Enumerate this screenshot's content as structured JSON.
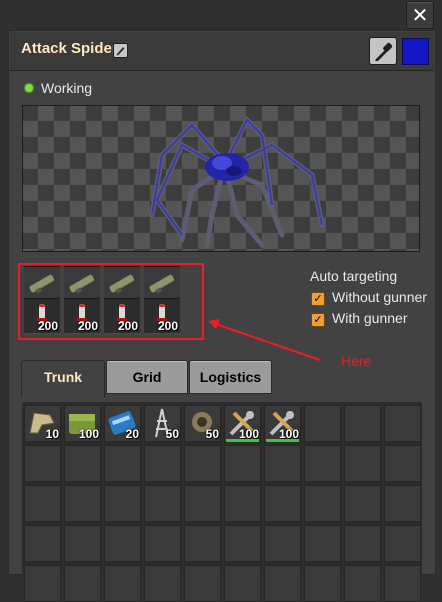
{
  "window": {
    "title": "Attack Spider",
    "close_glyph": "✕",
    "color_swatch": "#1216c4"
  },
  "status": {
    "text": "Working",
    "color": "#7de22f"
  },
  "ammo_slots": {
    "guns": [
      {
        "icon": "rocket-launcher-icon"
      },
      {
        "icon": "rocket-launcher-icon"
      },
      {
        "icon": "rocket-launcher-icon"
      },
      {
        "icon": "rocket-launcher-icon"
      }
    ],
    "ammo": [
      {
        "icon": "rocket-icon",
        "count": "200"
      },
      {
        "icon": "rocket-icon",
        "count": "200"
      },
      {
        "icon": "rocket-icon",
        "count": "200"
      },
      {
        "icon": "rocket-icon",
        "count": "200"
      }
    ]
  },
  "auto_targeting": {
    "title": "Auto targeting",
    "options": [
      {
        "label": "Without gunner",
        "checked": true
      },
      {
        "label": "With gunner",
        "checked": true
      }
    ]
  },
  "annotation": {
    "text": "Here",
    "color": "#ee1c24"
  },
  "tabs": [
    {
      "label": "Trunk",
      "active": true
    },
    {
      "label": "Grid",
      "active": false
    },
    {
      "label": "Logistics",
      "active": false
    }
  ],
  "trunk_items": [
    {
      "icon": "exoskeleton-icon",
      "count": "10"
    },
    {
      "icon": "landfill-icon",
      "count": "100"
    },
    {
      "icon": "battery-module-icon",
      "count": "20"
    },
    {
      "icon": "roboport-tower-icon",
      "count": "50"
    },
    {
      "icon": "grenade-launcher-icon",
      "count": "50"
    },
    {
      "icon": "repair-pack-icon",
      "count": "100",
      "durability": 1.0
    },
    {
      "icon": "repair-pack-icon",
      "count": "100",
      "durability": 1.0
    }
  ]
}
